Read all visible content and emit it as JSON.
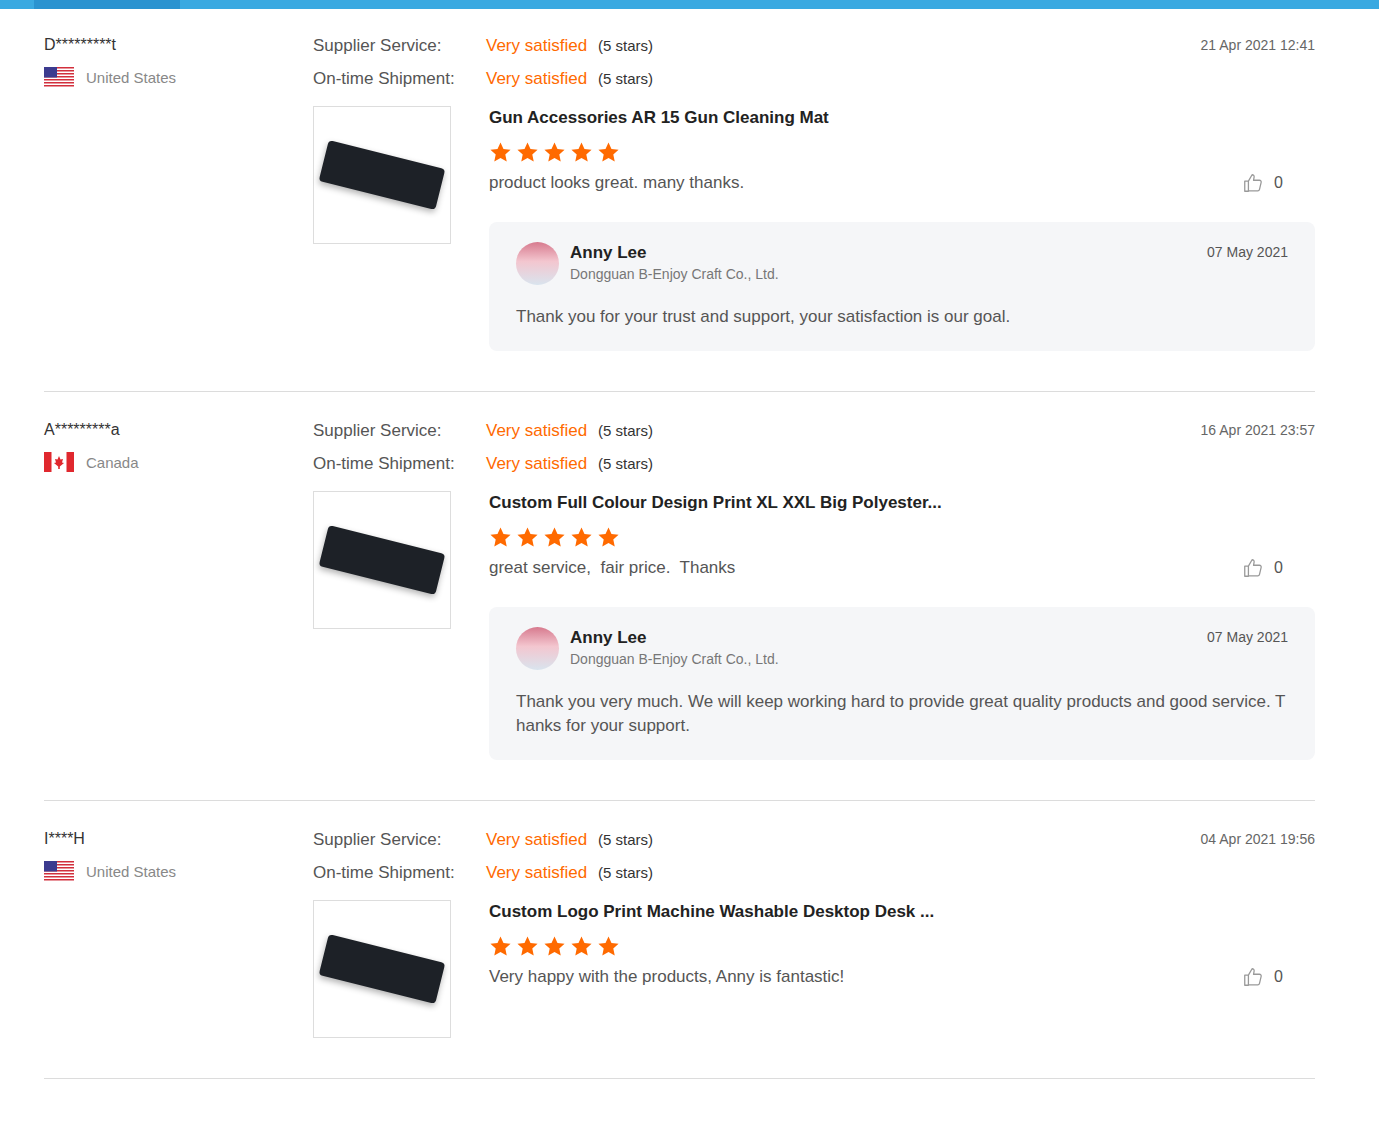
{
  "reviews": [
    {
      "user": "D*********t",
      "country": "United States",
      "flag": "us",
      "date": "21 Apr 2021 12:41",
      "ratings": [
        {
          "label": "Supplier Service:",
          "value": "Very satisfied",
          "note": "(5 stars)"
        },
        {
          "label": "On-time Shipment:",
          "value": "Very satisfied",
          "note": "(5 stars)"
        }
      ],
      "product": "Gun Accessories AR 15 Gun Cleaning Mat",
      "stars": 5,
      "comment": "product looks great. many thanks.",
      "likes": "0",
      "reply": {
        "name": "Anny Lee",
        "company": "Dongguan B-Enjoy Craft Co., Ltd.",
        "date": "07 May 2021",
        "text": "Thank you for your trust and support, your satisfaction is our goal."
      }
    },
    {
      "user": "A*********a",
      "country": "Canada",
      "flag": "ca",
      "date": "16 Apr 2021 23:57",
      "ratings": [
        {
          "label": "Supplier Service:",
          "value": "Very satisfied",
          "note": "(5 stars)"
        },
        {
          "label": "On-time Shipment:",
          "value": "Very satisfied",
          "note": "(5 stars)"
        }
      ],
      "product": "Custom Full Colour Design Print XL XXL Big Polyester...",
      "stars": 5,
      "comment": "great service,  fair price.  Thanks",
      "likes": "0",
      "reply": {
        "name": "Anny Lee",
        "company": "Dongguan B-Enjoy Craft Co., Ltd.",
        "date": "07 May 2021",
        "text": "Thank you very much. We will keep working hard to provide great quality products and good service. Thanks for your support."
      }
    },
    {
      "user": "I****H",
      "country": "United States",
      "flag": "us",
      "date": "04 Apr 2021 19:56",
      "ratings": [
        {
          "label": "Supplier Service:",
          "value": "Very satisfied",
          "note": "(5 stars)"
        },
        {
          "label": "On-time Shipment:",
          "value": "Very satisfied",
          "note": "(5 stars)"
        }
      ],
      "product": "Custom Logo Print Machine Washable Desktop Desk ...",
      "stars": 5,
      "comment": "Very happy with the products, Anny is fantastic!",
      "likes": "0",
      "reply": null
    }
  ]
}
